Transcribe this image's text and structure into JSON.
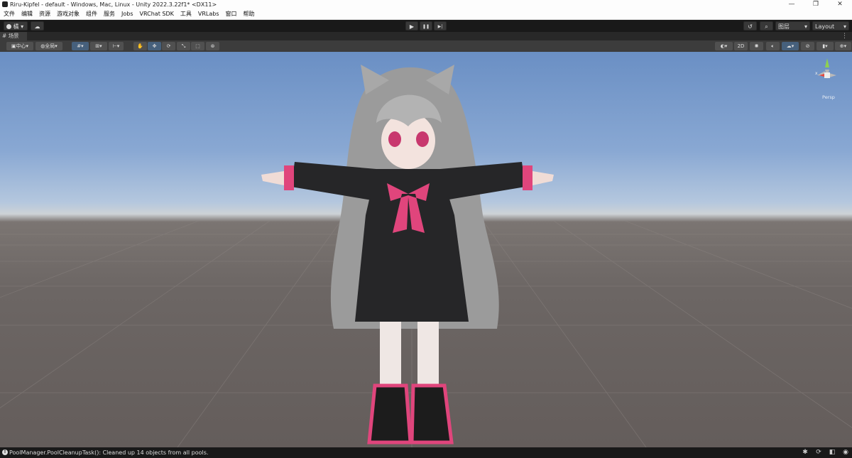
{
  "window": {
    "title": "Riru-Kipfel - default - Windows, Mac, Linux - Unity 2022.3.22f1* <DX11>",
    "minimize_glyph": "—",
    "maximize_glyph": "❐",
    "close_glyph": "✕"
  },
  "menu": [
    "文件",
    "编辑",
    "资源",
    "游戏对象",
    "组件",
    "服务",
    "Jobs",
    "VRChat SDK",
    "工具",
    "VRLabs",
    "窗口",
    "帮助"
  ],
  "toolbar": {
    "account_label": "橘",
    "play_glyph": "▶",
    "pause_glyph": "❚❚",
    "step_glyph": "▶|",
    "layers_label": "图层",
    "layout_label": "Layout"
  },
  "scene_tab": {
    "label": "场景"
  },
  "scene_toolbar": {
    "pivot_label": "中心",
    "global_label": "全局",
    "mode_2d_label": "2D"
  },
  "gizmo": {
    "projection_label": "Persp",
    "x_label": "x"
  },
  "status": {
    "message": "PoolManager.PoolCleanupTask(): Cleaned up 14 objects from all pools."
  }
}
